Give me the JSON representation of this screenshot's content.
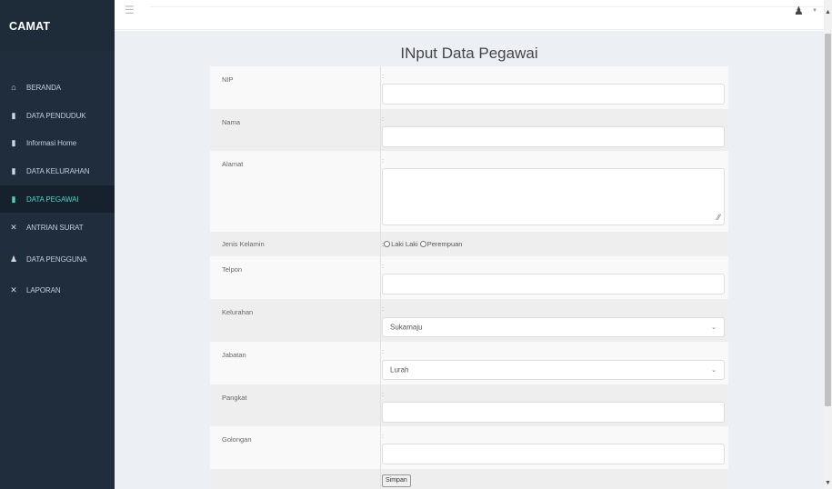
{
  "sidebar": {
    "brand": "CAMAT",
    "items": [
      {
        "label": "BERANDA",
        "icon": "home-icon",
        "glyph": "⌂"
      },
      {
        "label": "DATA PENDUDUK",
        "icon": "file-icon",
        "glyph": "▮"
      },
      {
        "label": "Informasi Home",
        "icon": "file-icon",
        "glyph": "▮"
      },
      {
        "label": "DATA KELURAHAN",
        "icon": "file-icon",
        "glyph": "▮"
      },
      {
        "label": "DATA PEGAWAI",
        "icon": "file-icon",
        "glyph": "▮",
        "active": true
      },
      {
        "label": "ANTRIAN SURAT",
        "icon": "tools-icon",
        "glyph": "✕"
      },
      {
        "label": "DATA PENGGUNA",
        "icon": "user-icon",
        "glyph": "♟"
      },
      {
        "label": "LAPORAN",
        "icon": "tools-icon",
        "glyph": "✕"
      }
    ]
  },
  "topbar": {
    "menu_icon": "hamburger-icon",
    "user_icon": "user-group-icon"
  },
  "page": {
    "title": "INput Data Pegawai"
  },
  "form": {
    "colon": ":",
    "fields": {
      "nip": {
        "label": "NIP",
        "value": ""
      },
      "nama": {
        "label": "Nama",
        "value": ""
      },
      "alamat": {
        "label": "Alamat",
        "value": ""
      },
      "jenis_kelamin": {
        "label": "Jenis Kelamin",
        "options": [
          "Laki Laki",
          "Perempuan"
        ],
        "selected": ""
      },
      "telpon": {
        "label": "Telpon",
        "value": ""
      },
      "kelurahan": {
        "label": "Kelurahan",
        "selected": "Sukamaju"
      },
      "jabatan": {
        "label": "Jabatan",
        "selected": "Lurah"
      },
      "pangkat": {
        "label": "Pangkat",
        "value": ""
      },
      "golongan": {
        "label": "Golongan",
        "value": ""
      }
    },
    "submit_label": "Simpan"
  },
  "colors": {
    "sidebar_bg": "#1f2d3d",
    "active_text": "#4fd3c4",
    "content_bg": "#ecf0f5"
  }
}
